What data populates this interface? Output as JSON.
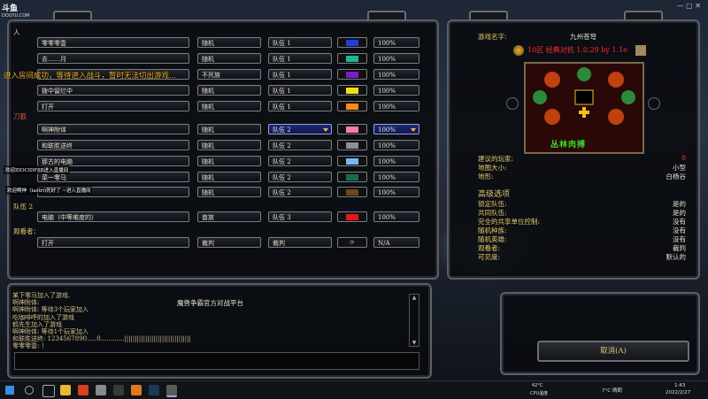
{
  "watermark": {
    "logo": "斗鱼",
    "url": "DOUYU.COM"
  },
  "colors": {
    "blue": "#1c3ee0",
    "teal": "#1ab89a",
    "purple": "#7a1cc8",
    "yellow": "#f0e010",
    "orange": "#ff8a10",
    "pink": "#ff7ab6",
    "gray": "#8d9096",
    "lightblue": "#7ab8f0",
    "darkgreen": "#1a6e48",
    "brown": "#6a4a1a",
    "red": "#e01818"
  },
  "team1_label": "队伍 1",
  "team1_icon_label": "人",
  "team1_rows": [
    {
      "name": "零零零壹",
      "race": "随机",
      "team": "队伍 1",
      "color": "blue",
      "handicap": "100%"
    },
    {
      "name": "去……月",
      "race": "随机",
      "team": "队伍 1",
      "color": "teal",
      "handicap": "100%"
    },
    {
      "name": "",
      "race": "不死族",
      "team": "队伍 1",
      "color": "purple",
      "handicap": "100%"
    },
    {
      "name": "拨中留烂中",
      "race": "随机",
      "team": "队伍 1",
      "color": "yellow",
      "handicap": "100%"
    },
    {
      "name": "打开",
      "race": "随机",
      "team": "队伍 1",
      "color": "orange",
      "handicap": "100%"
    }
  ],
  "team2_marker": "刀狠",
  "team2_rows": [
    {
      "name": "啊神附体",
      "race": "随机",
      "team": "队伍 2",
      "color": "pink",
      "handicap": "100%",
      "highlight": true
    },
    {
      "name": "和联胜送终",
      "race": "随机",
      "team": "队伍 2",
      "color": "gray",
      "handicap": "100%"
    },
    {
      "name": "那古的电脑",
      "race": "随机",
      "team": "队伍 2",
      "color": "lightblue",
      "handicap": "100%"
    },
    {
      "name": "菜一零马",
      "race": "随机",
      "team": "队伍 2",
      "color": "darkgreen",
      "handicap": "100%"
    },
    {
      "name": "",
      "race": "随机",
      "team": "队伍 2",
      "color": "brown",
      "handicap": "100%"
    }
  ],
  "team3_label": "队伍 2",
  "team3_rows": [
    {
      "name": "电脑（中等难度的）",
      "race": "兽族",
      "team": "队伍 3",
      "color": "red",
      "handicap": "100%"
    }
  ],
  "observer_label": "观看者：",
  "observer_row": {
    "name": "打开",
    "race": "裁判",
    "team": "裁判",
    "handicap": "N/A"
  },
  "orange_notice": "进入房间成功，等待进入战斗，暂时无法切出游戏...",
  "stream_overlay": [
    "欢迎ZIOCIDF8B进入直播间",
    "欢迎啊神（lastri)死好了 ~进入直播间"
  ],
  "game": {
    "name_label": "游戏名字:",
    "name_value": "九州苍穹",
    "map_title": "10区 经典对抗 1.0.29 by 1.1e"
  },
  "map_caption": "丛林肉搏",
  "info": [
    {
      "k": "建议的玩家:",
      "v": "8"
    },
    {
      "k": "地图大小:",
      "v": "小型"
    },
    {
      "k": "地形:",
      "v": "白杨谷"
    }
  ],
  "advanced_title": "高级选项",
  "advanced": [
    {
      "k": "锁定队伍:",
      "v": "是的"
    },
    {
      "k": "共同队伍:",
      "v": "是的"
    },
    {
      "k": "完全的共享单位控制:",
      "v": "没有"
    },
    {
      "k": "随机种族:",
      "v": "没有"
    },
    {
      "k": "随机英雄:",
      "v": "没有"
    },
    {
      "k": "观看者:",
      "v": "裁判"
    },
    {
      "k": "可见度:",
      "v": "默认的"
    }
  ],
  "chat": [
    "某下零马加入了游戏.",
    "啊神附体:",
    "啊神附体:  等待3个玩家加入",
    "吃咖啡呼的加入了游戏",
    "鹤先生加入了游戏",
    "啊神附体:  等待1个玩家加入",
    "和联胜送终:  1234567890.....0............||||||||||||||||||||||||||||||||",
    "零零零壹:  ！"
  ],
  "chat_center": "魔兽争霸官方对战平台",
  "cancel_button": "取消(A)",
  "taskbar": {
    "temp": "42°C",
    "cpu": "CPU温度",
    "weather": "7°C 晴朗",
    "time": "1:43",
    "date": "2022/2/27"
  }
}
